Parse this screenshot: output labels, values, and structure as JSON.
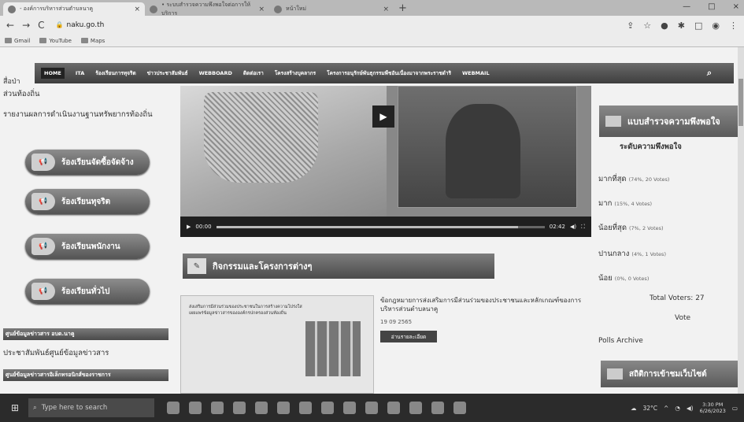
{
  "browser": {
    "tabs": [
      {
        "title": "- องค์การบริหารส่วนตำบลนาคู",
        "close": "×"
      },
      {
        "title": "• ระบบสำรวจความพึงพอใจต่อการให้บริการ",
        "close": "×"
      },
      {
        "title": "หน้าใหม่",
        "close": "×"
      }
    ],
    "new_tab": "+",
    "window_controls": {
      "minimize": "—",
      "maximize": "□",
      "close": "×"
    },
    "url": "naku.go.th",
    "bookmarks": [
      "Gmail",
      "YouTube",
      "Maps"
    ]
  },
  "nav": {
    "items": [
      "HOME",
      "ITA",
      "ร้องเรียนการทุจริต",
      "ข่าวประชาสัมพันธ์",
      "WEBBOARD",
      "ติดต่อเรา",
      "โครงสร้างบุคลากร",
      "โครงการอนุรักษ์พันธุกรรมพืชอันเนื่องมาจากพระราชดำริ",
      "WEBMAIL"
    ]
  },
  "left": {
    "partial_text": "สื่อป่า",
    "link": "ส่วนท้องถิ่น",
    "report": "รายงานผลการดำเนินงานฐานทรัพยากรท้องถิ่น",
    "buttons": [
      "ร้องเรียนจัดซื้อจัดจ้าง",
      "ร้องเรียนทุจริต",
      "ร้องเรียนพนักงาน",
      "ร้องเรียนทั่วไป"
    ],
    "info_center": "ศูนย์ข้อมูลข่าวสาร อบต.นาคู",
    "info_center_text": "ประชาสัมพันธ์ศูนย์ข้อมูลข่าวสาร",
    "electronic_info": "ศูนย์ข้อมูลข่าวสารอิเล็กทรอนิกส์ของราชการ"
  },
  "video": {
    "time_current": "00:00",
    "time_total": "02:42",
    "progress": 0.92
  },
  "activities": {
    "heading": "กิจกรรมและโครงการต่างๆ"
  },
  "news": {
    "image_text": "ส่งเสริมการมีส่วนร่วมของประชาชนในการสร้างความโปร่งใส เผยแพร่ข้อมูลข่าวสารขององค์กรปกครองส่วนท้องถิ่น",
    "title": "ข้อกฎหมายการส่งเสริมการมีส่วนร่วมของประชาชนและหลักเกณฑ์ของการบริหารส่วนตำบลนาคู",
    "date": "19 09 2565",
    "more": "อ่านรายละเอียด"
  },
  "survey": {
    "heading": "แบบสำรวจความพึงพอใจ",
    "question": "ระดับความพึงพอใจ",
    "options": [
      {
        "label": "มากที่สุด",
        "pct": "(74%, 20 Votes)"
      },
      {
        "label": "มาก",
        "pct": "(15%, 4 Votes)"
      },
      {
        "label": "น้อยที่สุด",
        "pct": "(7%, 2 Votes)"
      },
      {
        "label": "ปานกลาง",
        "pct": "(4%, 1 Votes)"
      },
      {
        "label": "น้อย",
        "pct": "(0%, 0 Votes)"
      }
    ],
    "total": "Total Voters: 27",
    "vote": "Vote",
    "archive": "Polls Archive",
    "stats": "สถิติการเข้าชมเว็บไซต์"
  },
  "taskbar": {
    "search": "Type here to search",
    "temp": "32°C",
    "time": "3:30 PM",
    "date": "6/26/2023"
  }
}
